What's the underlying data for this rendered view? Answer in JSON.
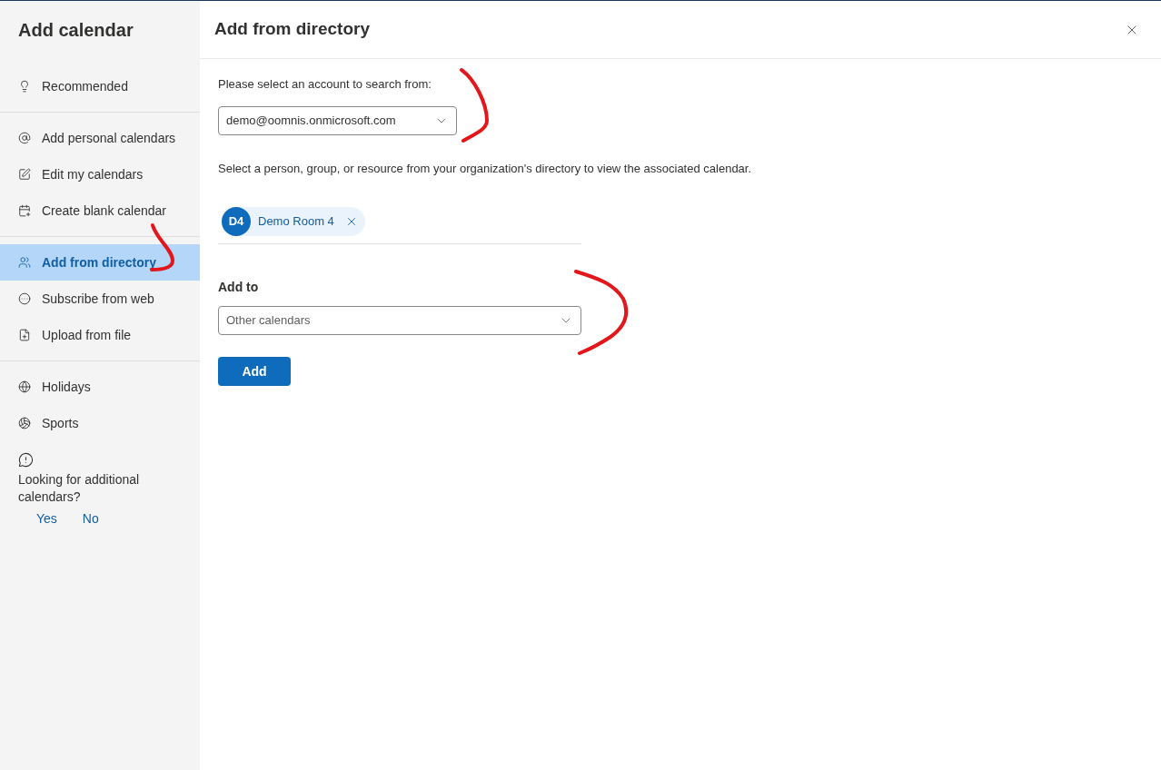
{
  "sidebar": {
    "title": "Add calendar",
    "groups": [
      [
        {
          "label": "Recommended",
          "selected": false
        }
      ],
      [
        {
          "label": "Add personal calendars",
          "selected": false
        },
        {
          "label": "Edit my calendars",
          "selected": false
        },
        {
          "label": "Create blank calendar",
          "selected": false
        }
      ],
      [
        {
          "label": "Add from directory",
          "selected": true
        },
        {
          "label": "Subscribe from web",
          "selected": false
        },
        {
          "label": "Upload from file",
          "selected": false
        }
      ],
      [
        {
          "label": "Holidays",
          "selected": false
        },
        {
          "label": "Sports",
          "selected": false
        }
      ]
    ],
    "feedback": {
      "question": "Looking for additional calendars?",
      "answers": [
        "Yes",
        "No"
      ]
    }
  },
  "panel": {
    "title": "Add from directory",
    "account_label": "Please select an account to search from:",
    "account_value": "demo@oomnis.onmicrosoft.com",
    "instructions": "Select a person, group, or resource from your organization's directory to view the associated calendar.",
    "chips": [
      {
        "initials": "D4",
        "name": "Demo Room 4"
      }
    ],
    "add_to_label": "Add to",
    "add_to_value": "Other calendars",
    "submit": "Add"
  }
}
